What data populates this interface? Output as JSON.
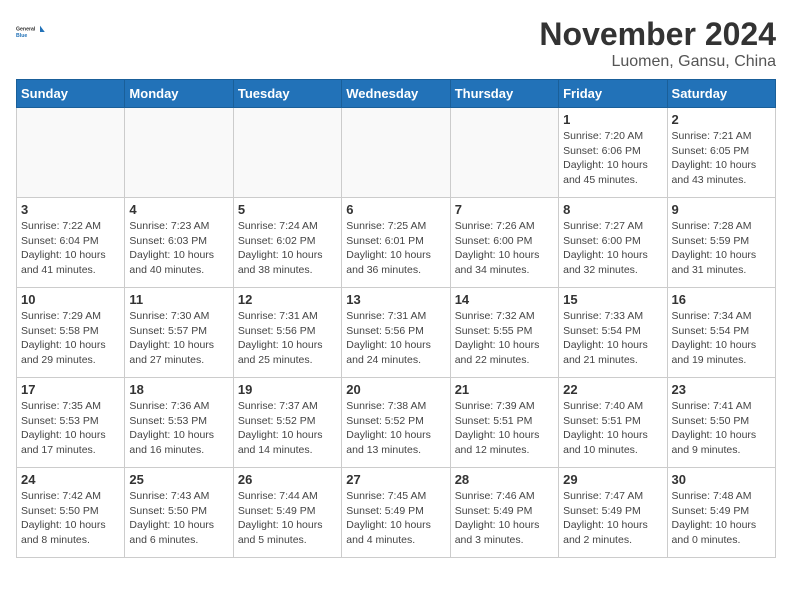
{
  "logo": {
    "line1": "General",
    "line2": "Blue"
  },
  "title": "November 2024",
  "location": "Luomen, Gansu, China",
  "weekdays": [
    "Sunday",
    "Monday",
    "Tuesday",
    "Wednesday",
    "Thursday",
    "Friday",
    "Saturday"
  ],
  "weeks": [
    [
      {
        "day": "",
        "info": "",
        "empty": true
      },
      {
        "day": "",
        "info": "",
        "empty": true
      },
      {
        "day": "",
        "info": "",
        "empty": true
      },
      {
        "day": "",
        "info": "",
        "empty": true
      },
      {
        "day": "",
        "info": "",
        "empty": true
      },
      {
        "day": "1",
        "info": "Sunrise: 7:20 AM\nSunset: 6:06 PM\nDaylight: 10 hours\nand 45 minutes."
      },
      {
        "day": "2",
        "info": "Sunrise: 7:21 AM\nSunset: 6:05 PM\nDaylight: 10 hours\nand 43 minutes."
      }
    ],
    [
      {
        "day": "3",
        "info": "Sunrise: 7:22 AM\nSunset: 6:04 PM\nDaylight: 10 hours\nand 41 minutes."
      },
      {
        "day": "4",
        "info": "Sunrise: 7:23 AM\nSunset: 6:03 PM\nDaylight: 10 hours\nand 40 minutes."
      },
      {
        "day": "5",
        "info": "Sunrise: 7:24 AM\nSunset: 6:02 PM\nDaylight: 10 hours\nand 38 minutes."
      },
      {
        "day": "6",
        "info": "Sunrise: 7:25 AM\nSunset: 6:01 PM\nDaylight: 10 hours\nand 36 minutes."
      },
      {
        "day": "7",
        "info": "Sunrise: 7:26 AM\nSunset: 6:00 PM\nDaylight: 10 hours\nand 34 minutes."
      },
      {
        "day": "8",
        "info": "Sunrise: 7:27 AM\nSunset: 6:00 PM\nDaylight: 10 hours\nand 32 minutes."
      },
      {
        "day": "9",
        "info": "Sunrise: 7:28 AM\nSunset: 5:59 PM\nDaylight: 10 hours\nand 31 minutes."
      }
    ],
    [
      {
        "day": "10",
        "info": "Sunrise: 7:29 AM\nSunset: 5:58 PM\nDaylight: 10 hours\nand 29 minutes."
      },
      {
        "day": "11",
        "info": "Sunrise: 7:30 AM\nSunset: 5:57 PM\nDaylight: 10 hours\nand 27 minutes."
      },
      {
        "day": "12",
        "info": "Sunrise: 7:31 AM\nSunset: 5:56 PM\nDaylight: 10 hours\nand 25 minutes."
      },
      {
        "day": "13",
        "info": "Sunrise: 7:31 AM\nSunset: 5:56 PM\nDaylight: 10 hours\nand 24 minutes."
      },
      {
        "day": "14",
        "info": "Sunrise: 7:32 AM\nSunset: 5:55 PM\nDaylight: 10 hours\nand 22 minutes."
      },
      {
        "day": "15",
        "info": "Sunrise: 7:33 AM\nSunset: 5:54 PM\nDaylight: 10 hours\nand 21 minutes."
      },
      {
        "day": "16",
        "info": "Sunrise: 7:34 AM\nSunset: 5:54 PM\nDaylight: 10 hours\nand 19 minutes."
      }
    ],
    [
      {
        "day": "17",
        "info": "Sunrise: 7:35 AM\nSunset: 5:53 PM\nDaylight: 10 hours\nand 17 minutes."
      },
      {
        "day": "18",
        "info": "Sunrise: 7:36 AM\nSunset: 5:53 PM\nDaylight: 10 hours\nand 16 minutes."
      },
      {
        "day": "19",
        "info": "Sunrise: 7:37 AM\nSunset: 5:52 PM\nDaylight: 10 hours\nand 14 minutes."
      },
      {
        "day": "20",
        "info": "Sunrise: 7:38 AM\nSunset: 5:52 PM\nDaylight: 10 hours\nand 13 minutes."
      },
      {
        "day": "21",
        "info": "Sunrise: 7:39 AM\nSunset: 5:51 PM\nDaylight: 10 hours\nand 12 minutes."
      },
      {
        "day": "22",
        "info": "Sunrise: 7:40 AM\nSunset: 5:51 PM\nDaylight: 10 hours\nand 10 minutes."
      },
      {
        "day": "23",
        "info": "Sunrise: 7:41 AM\nSunset: 5:50 PM\nDaylight: 10 hours\nand 9 minutes."
      }
    ],
    [
      {
        "day": "24",
        "info": "Sunrise: 7:42 AM\nSunset: 5:50 PM\nDaylight: 10 hours\nand 8 minutes."
      },
      {
        "day": "25",
        "info": "Sunrise: 7:43 AM\nSunset: 5:50 PM\nDaylight: 10 hours\nand 6 minutes."
      },
      {
        "day": "26",
        "info": "Sunrise: 7:44 AM\nSunset: 5:49 PM\nDaylight: 10 hours\nand 5 minutes."
      },
      {
        "day": "27",
        "info": "Sunrise: 7:45 AM\nSunset: 5:49 PM\nDaylight: 10 hours\nand 4 minutes."
      },
      {
        "day": "28",
        "info": "Sunrise: 7:46 AM\nSunset: 5:49 PM\nDaylight: 10 hours\nand 3 minutes."
      },
      {
        "day": "29",
        "info": "Sunrise: 7:47 AM\nSunset: 5:49 PM\nDaylight: 10 hours\nand 2 minutes."
      },
      {
        "day": "30",
        "info": "Sunrise: 7:48 AM\nSunset: 5:49 PM\nDaylight: 10 hours\nand 0 minutes."
      }
    ]
  ]
}
